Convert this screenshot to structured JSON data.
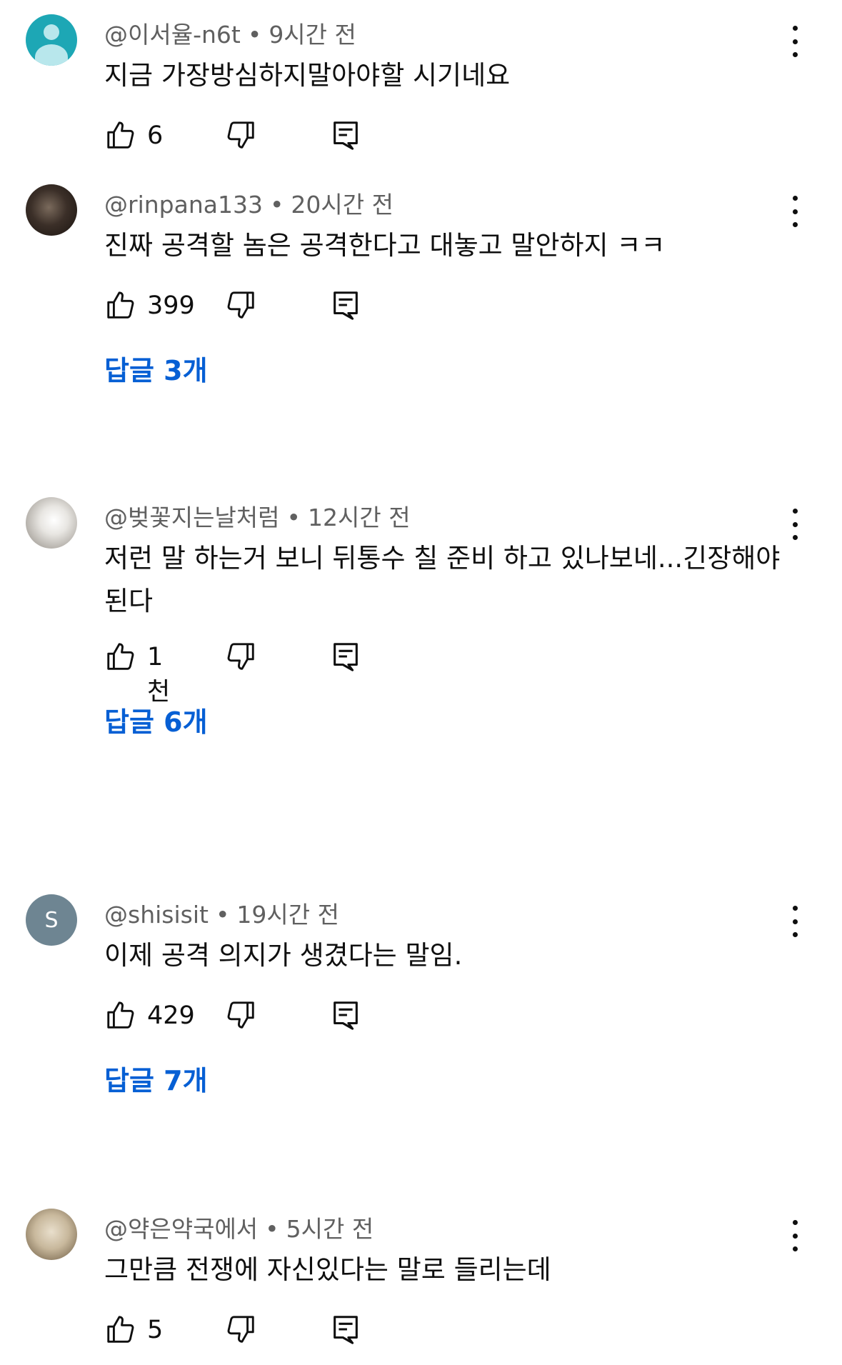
{
  "comments": [
    {
      "author": "@이서율-n6t",
      "time": "9시간 전",
      "text": "지금 가장방심하지말아야할 시기네요",
      "likes": "6",
      "replies_label": ""
    },
    {
      "author": "@rinpana133",
      "time": "20시간 전",
      "text": "진짜 공격할 놈은 공격한다고 대놓고 말안하지 ㅋㅋ",
      "likes": "399",
      "replies_label": "답글 3개"
    },
    {
      "author": "@벚꽃지는날처럼",
      "time": "12시간 전",
      "text": "저런 말 하는거 보니 뒤통수 칠 준비 하고 있나보네...긴장해야된다",
      "likes": "1천",
      "replies_label": "답글 6개"
    },
    {
      "author": "@shisisit",
      "time": "19시간 전",
      "text": "이제 공격 의지가 생겼다는 말임.",
      "likes": "429",
      "replies_label": "답글 7개",
      "avatar_letter": "S"
    },
    {
      "author": "@약은약국에서",
      "time": "5시간 전",
      "text": "그만큼 전쟁에 자신있다는 말로 들리는데",
      "likes": "5",
      "replies_label": ""
    }
  ],
  "separator": "•",
  "colors": {
    "link": "#065fd4",
    "meta": "#606060",
    "text": "#0f0f0f"
  },
  "icons": [
    "thumbs-up-icon",
    "thumbs-down-icon",
    "reply-icon",
    "more-vert-icon"
  ]
}
